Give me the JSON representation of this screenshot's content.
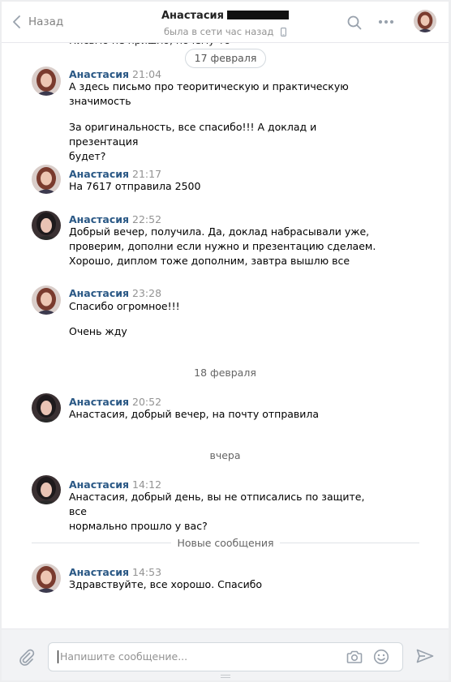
{
  "header": {
    "back_label": "Назад",
    "peer_name": "Анастасия",
    "peer_status": "была в сети час назад"
  },
  "clipped_message": "Письмо не пришло, почему-то",
  "current_date_pill": "17 февраля",
  "messages": [
    {
      "author": "Анастасия",
      "time": "21:04",
      "avatar": "female-avatar-red-hair",
      "lines": [
        "А здесь письмо про теоритическую и практическую",
        "значимость"
      ]
    },
    {
      "lines": [
        "За оригинальность, все спасибо!!! А доклад и презентация",
        "будет?"
      ]
    },
    {
      "author": "Анастасия",
      "time": "21:17",
      "avatar": "female-avatar-red-hair",
      "lines": [
        "На 7617 отправила 2500"
      ]
    },
    {
      "author": "Анастасия",
      "time": "22:52",
      "avatar": "female-avatar-dark-hair",
      "lines": [
        "Добрый вечер, получила. Да, доклад набрасывали уже,",
        "проверим, дополни если нужно и презентацию сделаем.",
        "Хорошо, диплом тоже дополним, завтра вышлю все"
      ]
    },
    {
      "author": "Анастасия",
      "time": "23:28",
      "avatar": "female-avatar-red-hair",
      "lines": [
        "Спасибо огромное!!!"
      ]
    },
    {
      "lines": [
        "Очень жду"
      ]
    },
    {
      "author": "Анастасия",
      "time": "20:52",
      "avatar": "female-avatar-dark-hair",
      "lines": [
        "Анастасия, добрый вечер, на почту отправила"
      ]
    },
    {
      "author": "Анастасия",
      "time": "14:12",
      "avatar": "female-avatar-dark-hair",
      "lines": [
        "Анастасия, добрый день, вы не отписались по защите, все",
        "нормально прошло у вас?"
      ]
    },
    {
      "author": "Анастасия",
      "time": "14:53",
      "avatar": "female-avatar-red-hair",
      "lines": [
        "Здравствуйте, все хорошо. Спасибо"
      ]
    }
  ],
  "date_separators": [
    "18 февраля",
    "вчера"
  ],
  "new_messages_label": "Новые сообщения",
  "composer": {
    "placeholder": "Напишите сообщение..."
  },
  "colors": {
    "author": "#2a5885",
    "time": "#939393",
    "border": "#d3d9de",
    "background": "#edeef0"
  }
}
